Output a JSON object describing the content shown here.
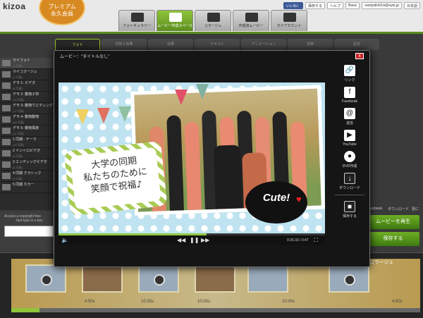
{
  "app": {
    "logo": "kizoa",
    "premium_line1": "プレミアム",
    "premium_line2": "永久会員"
  },
  "main_tabs": [
    "フォトギャラリー",
    "ムービー作成スペース",
    "コラージュ",
    "作成済ムービー",
    "マイアカウント"
  ],
  "user": {
    "like": "いいね！",
    "share": "保存する",
    "help": "ヘルプ",
    "plan": "Basic",
    "email": "oamjsdlv62vi@sute.jp",
    "lang": "日本語"
  },
  "sub_tabs": [
    "フォト",
    "切替え効果",
    "効果",
    "テキスト",
    "アニメーション",
    "音楽",
    "設定"
  ],
  "sidebar": [
    {
      "label": "マイフォト",
      "sub": "(1 写真)"
    },
    {
      "label": "マイコラージュ",
      "sub": "(1 写真)"
    },
    {
      "label": "デモ 1- ビデオ",
      "sub": "(6 写真)"
    },
    {
      "label": "デモ 2- 動物子供",
      "sub": "(18 写真)"
    },
    {
      "label": "デモ 3- 動物ウエディング",
      "sub": "(17 写真)"
    },
    {
      "label": "デモ 4- 動物動物",
      "sub": "(10 写真)"
    },
    {
      "label": "デモ 5- 動物風景",
      "sub": "(11 写真)"
    },
    {
      "label": "1 同期 - テーマ",
      "sub": "(10 写真)"
    },
    {
      "label": "2 イントロビデオ",
      "sub": "(8 写真)"
    },
    {
      "label": "3 エンディングビデオ",
      "sub": "(8 写真)"
    },
    {
      "label": "4 同期 クラシック",
      "sub": "(9 写真)"
    },
    {
      "label": "5 同期 カラー",
      "sub": ""
    }
  ],
  "search": {
    "line1": "Access a copyright free",
    "line2": "Just type in a key"
  },
  "right_buttons": {
    "play": "ムービーを再生",
    "save": "保存する",
    "facebook": "Facebook",
    "download": "ダウンロード",
    "more": "更に"
  },
  "timeline": {
    "label": "アニメコラージュ",
    "times": [
      "4.50s",
      "10.00s",
      "10.00s",
      "10.00s",
      "4.50s"
    ]
  },
  "modal": {
    "title": "ムービー：\"タイトルなし\"",
    "close": "x"
  },
  "video": {
    "text_line1": "大学の同期",
    "text_line2": "私たちのために",
    "text_line3": "笑顔で祝福♪",
    "sticker": "Cute!",
    "time": "0:26.33 / 0:47"
  },
  "share": [
    {
      "icon": "link-icon",
      "label": "リンク"
    },
    {
      "icon": "facebook-icon",
      "label": "Facebook"
    },
    {
      "icon": "mail-icon",
      "label": "送信"
    },
    {
      "icon": "youtube-icon",
      "label": "YouTube"
    },
    {
      "icon": "dvd-icon",
      "label": "DVD作成"
    },
    {
      "icon": "download-icon",
      "label": "ダウンロード"
    },
    {
      "icon": "save-icon",
      "label": "保存する"
    }
  ]
}
